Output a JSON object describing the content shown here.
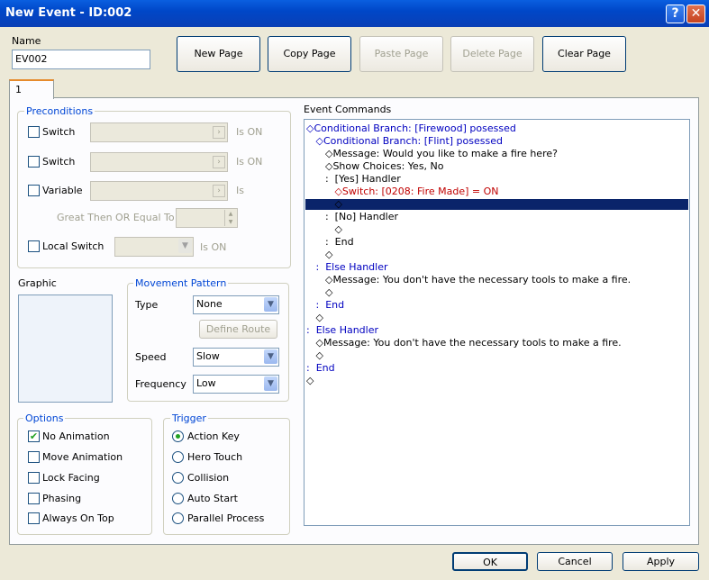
{
  "window": {
    "title": "New Event - ID:002",
    "help": "?",
    "close": "✕"
  },
  "name": {
    "label": "Name",
    "value": "EV002"
  },
  "toolbar": {
    "new_page": "New Page",
    "copy_page": "Copy Page",
    "paste_page": "Paste Page",
    "delete_page": "Delete Page",
    "clear_page": "Clear Page"
  },
  "tabs": [
    "1"
  ],
  "preconditions": {
    "title": "Preconditions",
    "switch1": {
      "label": "Switch",
      "suffix": "Is ON"
    },
    "switch2": {
      "label": "Switch",
      "suffix": "Is ON"
    },
    "variable": {
      "label": "Variable",
      "suffix": "Is"
    },
    "gte_label": "Great Then OR Equal To",
    "local_switch": {
      "label": "Local Switch",
      "suffix": "Is ON"
    }
  },
  "graphic": {
    "label": "Graphic"
  },
  "movement": {
    "title": "Movement Pattern",
    "type_label": "Type",
    "type_value": "None",
    "define_route": "Define Route",
    "speed_label": "Speed",
    "speed_value": "Slow",
    "frequency_label": "Frequency",
    "frequency_value": "Low"
  },
  "options": {
    "title": "Options",
    "items": [
      {
        "label": "No Animation",
        "checked": true
      },
      {
        "label": "Move Animation",
        "checked": false
      },
      {
        "label": "Lock Facing",
        "checked": false
      },
      {
        "label": "Phasing",
        "checked": false
      },
      {
        "label": "Always On Top",
        "checked": false
      }
    ]
  },
  "trigger": {
    "title": "Trigger",
    "items": [
      {
        "label": "Action Key",
        "selected": true
      },
      {
        "label": "Hero Touch",
        "selected": false
      },
      {
        "label": "Collision",
        "selected": false
      },
      {
        "label": "Auto Start",
        "selected": false
      },
      {
        "label": "Parallel Process",
        "selected": false
      }
    ]
  },
  "event_commands": {
    "label": "Event Commands",
    "lines": [
      {
        "text": "◇Conditional Branch: [Firewood] posessed",
        "color": "blue"
      },
      {
        "text": "   ◇Conditional Branch: [Flint] posessed",
        "color": "blue"
      },
      {
        "text": "      ◇Message: Would you like to make a fire here?",
        "color": "black"
      },
      {
        "text": "      ◇Show Choices: Yes, No",
        "color": "black"
      },
      {
        "text": "      :  [Yes] Handler",
        "color": "black"
      },
      {
        "text": "         ◇Switch: [0208: Fire Made] = ON",
        "color": "red"
      },
      {
        "text": "         ◇",
        "color": "black"
      },
      {
        "text": "      :  [No] Handler",
        "color": "black"
      },
      {
        "text": "         ◇",
        "color": "black"
      },
      {
        "text": "      :  End",
        "color": "black"
      },
      {
        "text": "      ◇",
        "color": "black"
      },
      {
        "text": "   :  Else Handler",
        "color": "blue"
      },
      {
        "text": "      ◇Message: You don't have the necessary tools to make a fire.",
        "color": "black"
      },
      {
        "text": "      ◇",
        "color": "black"
      },
      {
        "text": "   :  End",
        "color": "blue"
      },
      {
        "text": "   ◇",
        "color": "black"
      },
      {
        "text": ":  Else Handler",
        "color": "blue"
      },
      {
        "text": "   ◇Message: You don't have the necessary tools to make a fire.",
        "color": "black"
      },
      {
        "text": "   ◇",
        "color": "black"
      },
      {
        "text": ":  End",
        "color": "blue"
      },
      {
        "text": "◇",
        "color": "black"
      }
    ]
  },
  "footer": {
    "ok": "OK",
    "cancel": "Cancel",
    "apply": "Apply"
  }
}
